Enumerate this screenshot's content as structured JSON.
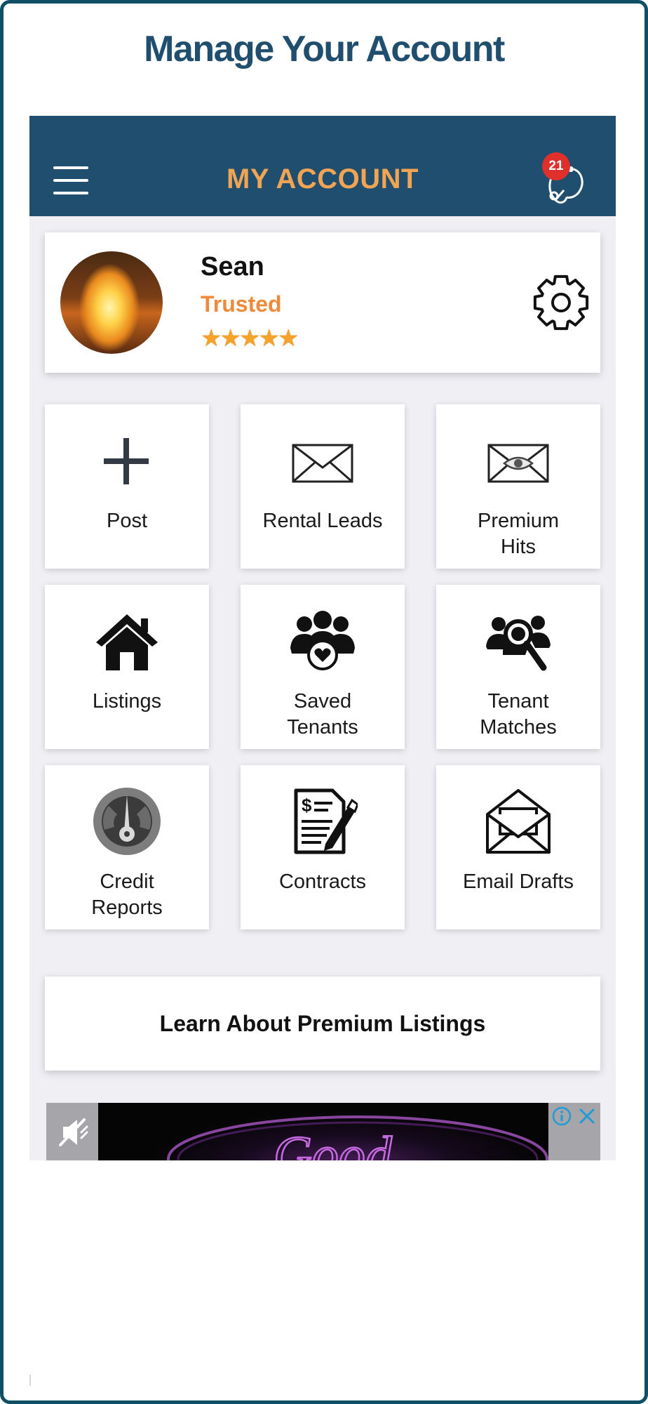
{
  "promo": {
    "title": "Manage Your Account"
  },
  "appbar": {
    "title": "MY ACCOUNT",
    "notification_count": "21"
  },
  "profile": {
    "name": "Sean",
    "status": "Trusted",
    "rating_stars": 5
  },
  "tiles": [
    {
      "label": "Post",
      "icon": "plus-icon"
    },
    {
      "label": "Rental Leads",
      "icon": "envelope-icon"
    },
    {
      "label": "Premium\nHits",
      "icon": "envelope-eye-icon"
    },
    {
      "label": "Listings",
      "icon": "house-icon"
    },
    {
      "label": "Saved\nTenants",
      "icon": "people-heart-icon"
    },
    {
      "label": "Tenant\nMatches",
      "icon": "people-search-icon"
    },
    {
      "label": "Credit\nReports",
      "icon": "gauge-icon"
    },
    {
      "label": "Contracts",
      "icon": "contract-pen-icon"
    },
    {
      "label": "Email Drafts",
      "icon": "open-envelope-icon"
    }
  ],
  "learn": {
    "label": "Learn About Premium Listings"
  },
  "ad": {
    "banner_text": "Good"
  },
  "colors": {
    "header_bg": "#1f4e6e",
    "header_title": "#f0a454",
    "status_orange": "#f0893a",
    "badge_red": "#e0302b",
    "frame_border": "#0f4f65",
    "star": "#f6a32b"
  }
}
